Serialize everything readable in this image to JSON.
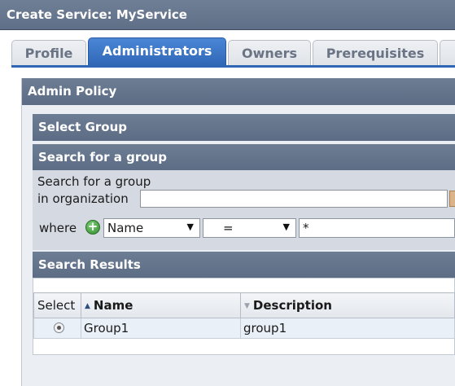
{
  "window": {
    "title": "Create Service: MyService"
  },
  "tabs": [
    {
      "label": "Profile",
      "active": false
    },
    {
      "label": "Administrators",
      "active": true
    },
    {
      "label": "Owners",
      "active": false
    },
    {
      "label": "Prerequisites",
      "active": false
    }
  ],
  "admin_policy": {
    "header": "Admin Policy"
  },
  "select_group": {
    "header": "Select Group"
  },
  "search": {
    "header": "Search for a group",
    "label_line1": "Search for a group",
    "label_line2": "in organization",
    "organization_value": "",
    "where_label": "where",
    "field_select": "Name",
    "operator_select": "=",
    "value_input": "*"
  },
  "results": {
    "header": "Search Results",
    "columns": [
      "Select",
      "Name",
      "Description"
    ],
    "rows": [
      {
        "name": "Group1",
        "description": "group1"
      }
    ]
  },
  "icons": {
    "add": "add-condition-icon",
    "sort_asc": "sort-ascending-icon",
    "sort_desc": "sort-descending-icon",
    "lookup": "calendar-lookup-icon"
  },
  "colors": {
    "active_tab": "#2f67b5",
    "section_header": "#64748b",
    "add_button": "#2f8a2a"
  }
}
